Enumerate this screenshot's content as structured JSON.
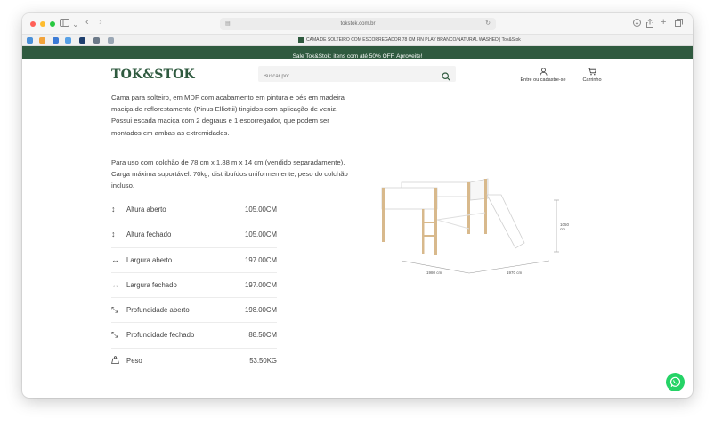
{
  "browser": {
    "url": "tokstok.com.br",
    "tab_title": "CAMA DE SOLTEIRO COM ESCORREGADOR 78 CM FIN PLAY BRANCO/NATURAL WASHED | Tok&Stok"
  },
  "promo": {
    "text": "Sale Tok&Stok: itens com até 50% OFF. Aproveite!"
  },
  "header": {
    "logo": "TOK&STOK",
    "search_placeholder": "Buscar por",
    "account_label": "Entre ou cadastre-se",
    "cart_label": "Carrinho"
  },
  "description": {
    "paragraph1": "Cama para solteiro, em MDF com acabamento em pintura e pés em madeira maciça de reflorestamento (Pinus Elliottii) tingidos com aplicação de veniz. Possui escada maciça com 2 degraus e 1 escorregador, que podem ser montados em ambas as extremidades.",
    "paragraph2": "Para uso com colchão de 78 cm x 1,88 m x 14 cm (vendido separadamente). Carga máxima suportável: 70kg; distribuídos uniformemente, peso do colchão incluso."
  },
  "specs": [
    {
      "icon": "vertical-arrows-icon",
      "label": "Altura aberto",
      "value": "105.00CM"
    },
    {
      "icon": "vertical-arrows-icon",
      "label": "Altura fechado",
      "value": "105.00CM"
    },
    {
      "icon": "horizontal-arrows-icon",
      "label": "Largura aberto",
      "value": "197.00CM"
    },
    {
      "icon": "horizontal-arrows-icon",
      "label": "Largura fechado",
      "value": "197.00CM"
    },
    {
      "icon": "diagonal-arrows-icon",
      "label": "Profundidade aberto",
      "value": "198.00CM"
    },
    {
      "icon": "diagonal-arrows-icon",
      "label": "Profundidade fechado",
      "value": "88.50CM"
    },
    {
      "icon": "weight-icon",
      "label": "Peso",
      "value": "53.50KG"
    }
  ],
  "drawing": {
    "height_label": "1050 cm",
    "width_label": "1980 cm",
    "depth_label": "1970 cm"
  },
  "colors": {
    "brand_green": "#2f5a3f",
    "whatsapp": "#25d366"
  }
}
